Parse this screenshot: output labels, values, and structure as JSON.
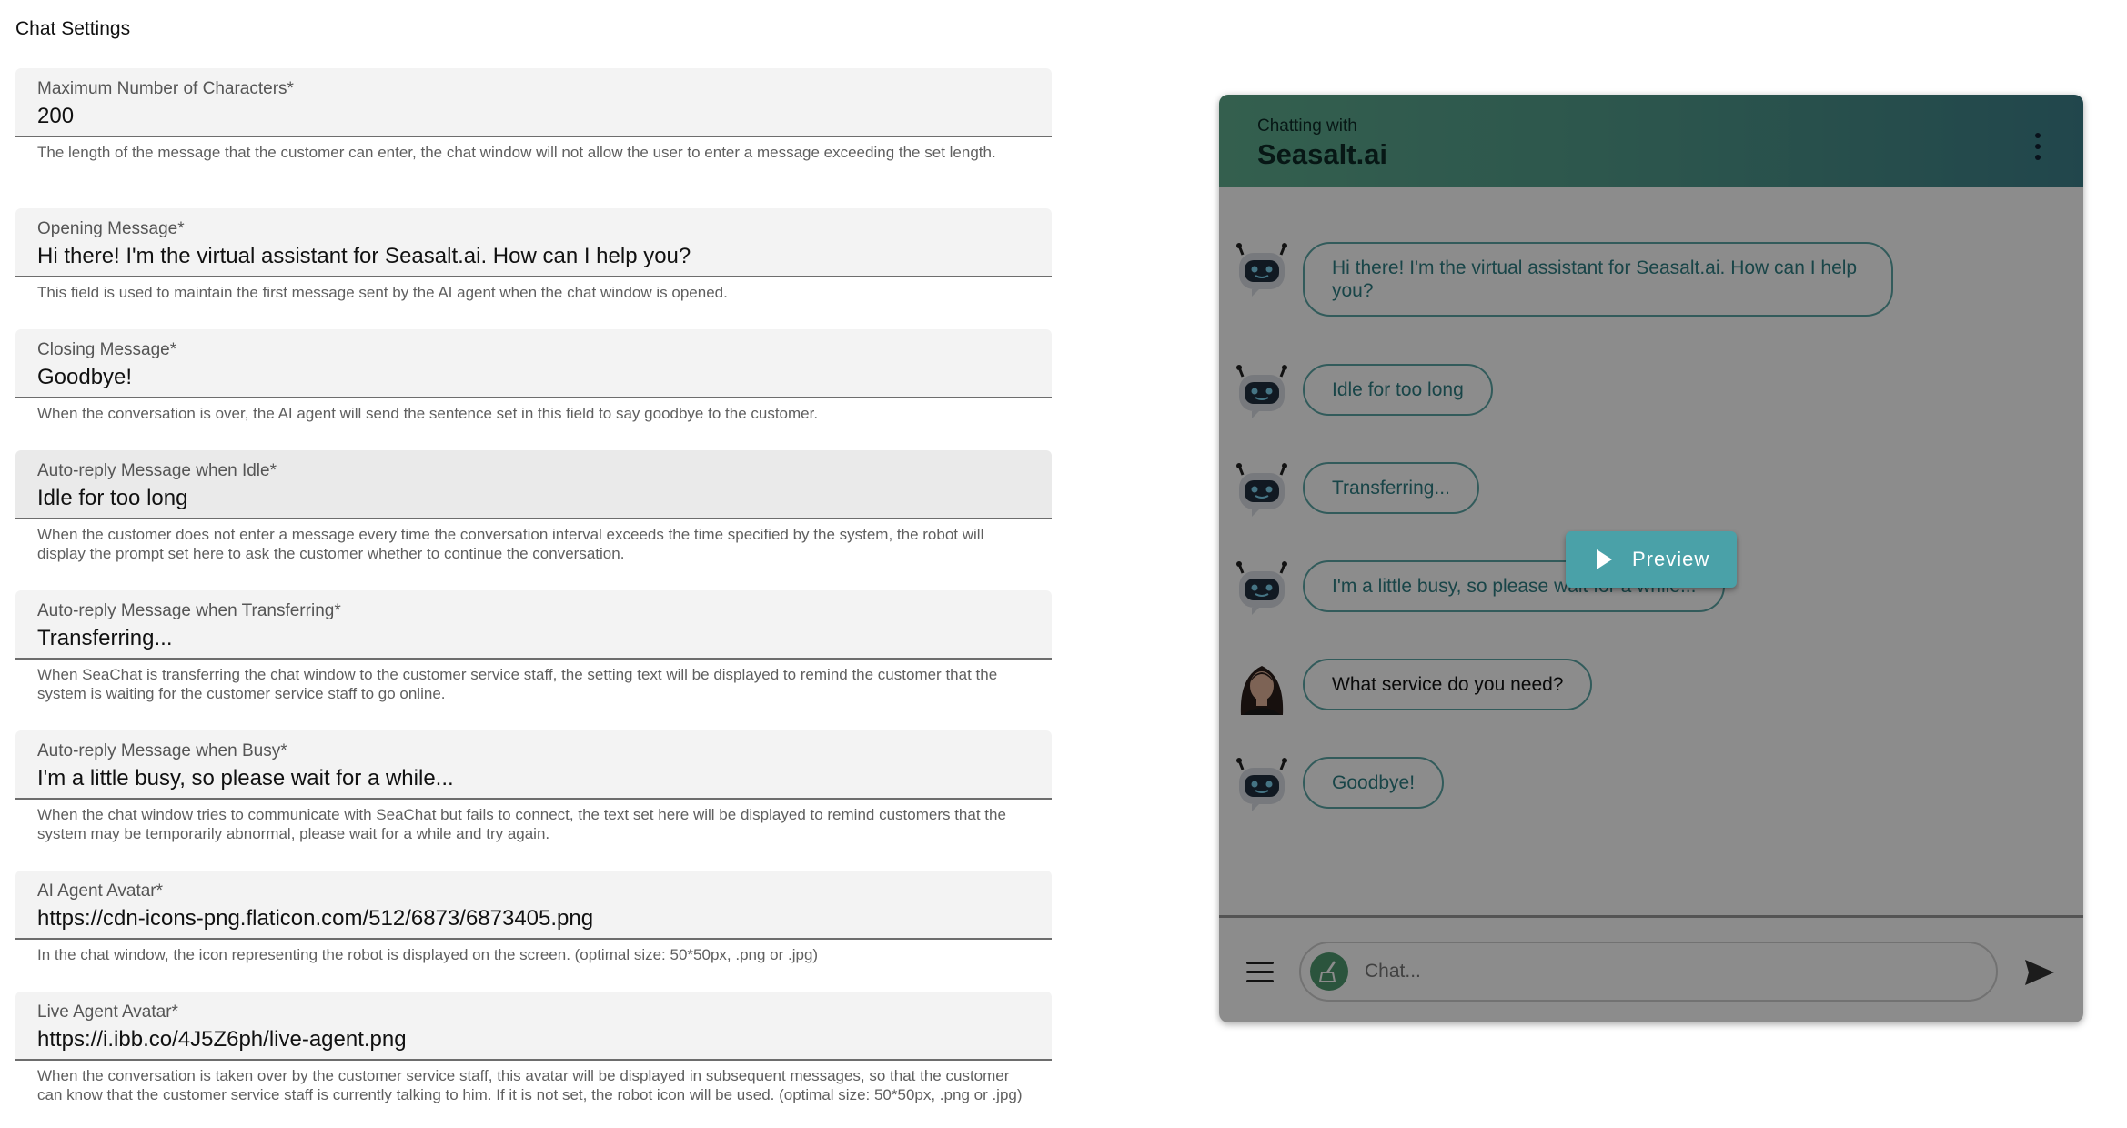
{
  "page": {
    "title": "Chat Settings"
  },
  "fields": [
    {
      "label": "Maximum Number of Characters",
      "value": "200",
      "help": "The length of the message that the customer can enter, the chat window will not allow the user to enter a message exceeding the set length."
    },
    {
      "label": "Opening Message",
      "value": "Hi there! I'm the virtual assistant for Seasalt.ai. How can I help you?",
      "help": "This field is used to maintain the first message sent by the AI agent when the chat window is opened."
    },
    {
      "label": "Closing Message",
      "value": "Goodbye!",
      "help": "When the conversation is over, the AI agent will send the sentence set in this field to say goodbye to the customer."
    },
    {
      "label": "Auto-reply Message when Idle",
      "value": "Idle for too long",
      "help": "When the customer does not enter a message every time the conversation interval exceeds the time specified by the system, the robot will display the prompt set here to ask the customer whether to continue the conversation."
    },
    {
      "label": "Auto-reply Message when Transferring",
      "value": "Transferring...",
      "help": "When SeaChat is transferring the chat window to the customer service staff, the setting text will be displayed to remind the customer that the system is waiting for the customer service staff to go online."
    },
    {
      "label": "Auto-reply Message when Busy",
      "value": "I'm a little busy, so please wait for a while...",
      "help": "When the chat window tries to communicate with SeaChat but fails to connect, the text set here will be displayed to remind customers that the system may be temporarily abnormal, please wait for a while and try again."
    },
    {
      "label": "AI Agent Avatar",
      "value": "https://cdn-icons-png.flaticon.com/512/6873/6873405.png",
      "help": "In the chat window, the icon representing the robot is displayed on the screen. (optimal size: 50*50px, .png or .jpg)"
    },
    {
      "label": "Live Agent Avatar",
      "value": "https://i.ibb.co/4J5Z6ph/live-agent.png",
      "help": "When the conversation is taken over by the customer service staff, this avatar will be displayed in subsequent messages, so that the customer can know that the customer service staff is currently talking to him. If it is not set, the robot icon will be used. (optimal size: 50*50px, .png or .jpg)"
    }
  ],
  "required_mark": "*",
  "chat": {
    "subtitle": "Chatting with",
    "name": "Seasalt.ai",
    "messages": [
      {
        "sender": "bot",
        "text": "Hi there! I'm the virtual assistant for Seasalt.ai. How can I help you?"
      },
      {
        "sender": "bot",
        "text": "Idle for too long"
      },
      {
        "sender": "bot",
        "text": "Transferring..."
      },
      {
        "sender": "bot",
        "text": "I'm a little busy, so please wait for a while..."
      },
      {
        "sender": "agent",
        "text": "What service do you need?"
      },
      {
        "sender": "bot",
        "text": "Goodbye!"
      }
    ],
    "input_placeholder": "Chat...",
    "preview_label": "Preview"
  },
  "colors": {
    "header_start": "#5fae8f",
    "header_end": "#3d808a",
    "bubble_border": "#5ba7a6",
    "preview": "#4aa1a8"
  },
  "icons": [
    "kebab-menu-icon",
    "robot-avatar-icon",
    "agent-avatar",
    "hamburger-icon",
    "broom-icon",
    "send-icon",
    "play-icon"
  ]
}
